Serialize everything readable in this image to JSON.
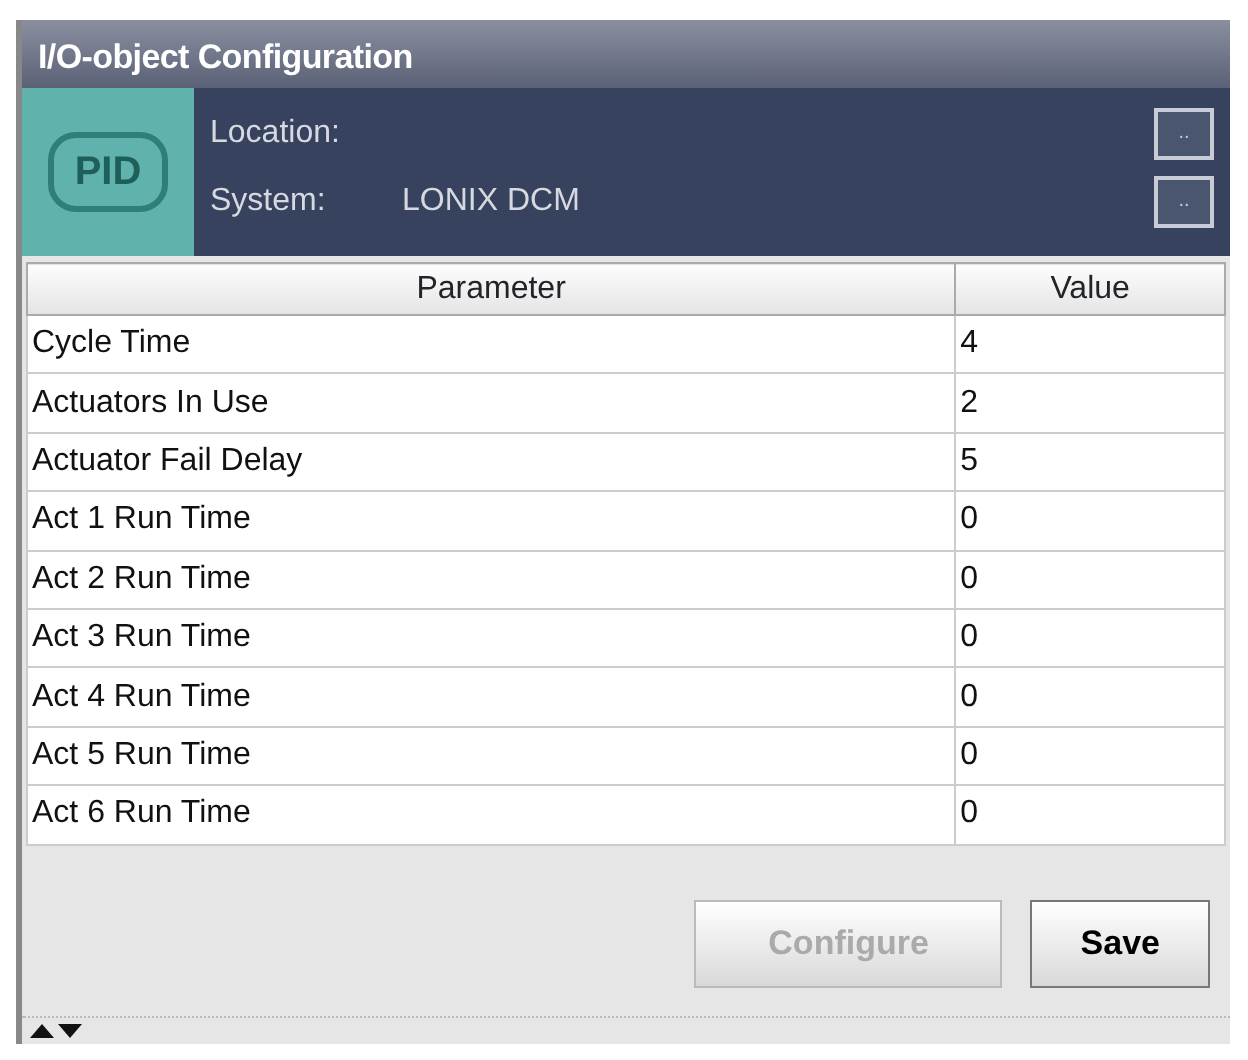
{
  "window": {
    "title": "I/O-object Configuration"
  },
  "header": {
    "badge": "PID",
    "fields": [
      {
        "label": "Location:",
        "button": ".."
      },
      {
        "label": "System:",
        "value": "LONIX DCM",
        "button": ".."
      }
    ]
  },
  "table": {
    "columns": [
      "Parameter",
      "Value"
    ],
    "rows": [
      {
        "parameter": "Cycle Time",
        "value": "4"
      },
      {
        "parameter": "Actuators In Use",
        "value": "2"
      },
      {
        "parameter": "Actuator Fail Delay",
        "value": "5"
      },
      {
        "parameter": "Act 1 Run Time",
        "value": "0"
      },
      {
        "parameter": "Act 2 Run Time",
        "value": "0"
      },
      {
        "parameter": "Act 3 Run Time",
        "value": "0"
      },
      {
        "parameter": "Act 4 Run Time",
        "value": "0"
      },
      {
        "parameter": "Act 5 Run Time",
        "value": "0"
      },
      {
        "parameter": "Act 6 Run Time",
        "value": "0"
      }
    ]
  },
  "buttons": [
    {
      "label": "Configure",
      "disabled": true
    },
    {
      "label": "Save",
      "disabled": false
    }
  ]
}
